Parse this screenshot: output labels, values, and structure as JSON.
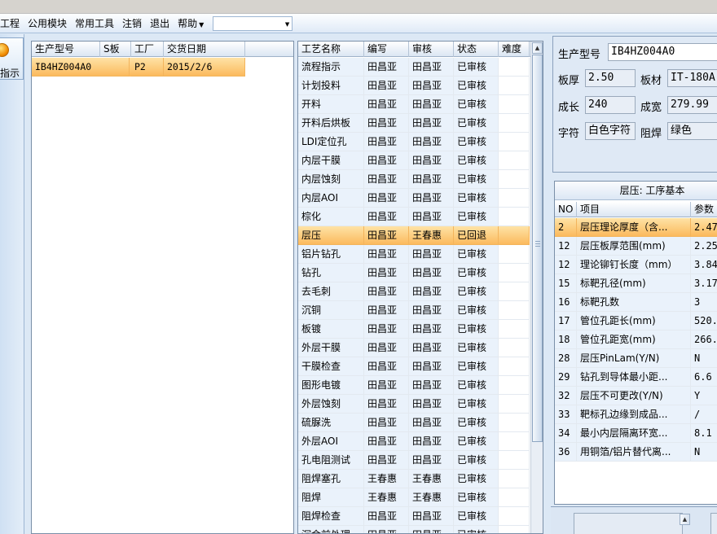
{
  "menu": {
    "items": [
      "工程",
      "公用模块",
      "常用工具",
      "注销",
      "退出",
      "帮助"
    ],
    "combo_value": ""
  },
  "leftbar": {
    "button_label": "指示"
  },
  "orders": {
    "headers": [
      "生产型号",
      "S板",
      "工厂",
      "交货日期"
    ],
    "rows": [
      {
        "model": "IB4HZ004A0",
        "s": "",
        "factory": "P2",
        "date": "2015/2/6"
      }
    ]
  },
  "processes": {
    "headers": [
      "工艺名称",
      "编写",
      "审核",
      "状态",
      "难度"
    ],
    "rows": [
      {
        "name": "流程指示",
        "writer": "田昌亚",
        "reviewer": "田昌亚",
        "status": "已审核"
      },
      {
        "name": "计划投料",
        "writer": "田昌亚",
        "reviewer": "田昌亚",
        "status": "已审核"
      },
      {
        "name": "开料",
        "writer": "田昌亚",
        "reviewer": "田昌亚",
        "status": "已审核"
      },
      {
        "name": "开料后烘板",
        "writer": "田昌亚",
        "reviewer": "田昌亚",
        "status": "已审核"
      },
      {
        "name": "LDI定位孔",
        "writer": "田昌亚",
        "reviewer": "田昌亚",
        "status": "已审核"
      },
      {
        "name": "内层干膜",
        "writer": "田昌亚",
        "reviewer": "田昌亚",
        "status": "已审核"
      },
      {
        "name": "内层蚀刻",
        "writer": "田昌亚",
        "reviewer": "田昌亚",
        "status": "已审核"
      },
      {
        "name": "内层AOI",
        "writer": "田昌亚",
        "reviewer": "田昌亚",
        "status": "已审核"
      },
      {
        "name": "棕化",
        "writer": "田昌亚",
        "reviewer": "田昌亚",
        "status": "已审核"
      },
      {
        "name": "层压",
        "writer": "田昌亚",
        "reviewer": "王春惠",
        "status": "已回退"
      },
      {
        "name": "铝片钻孔",
        "writer": "田昌亚",
        "reviewer": "田昌亚",
        "status": "已审核"
      },
      {
        "name": "钻孔",
        "writer": "田昌亚",
        "reviewer": "田昌亚",
        "status": "已审核"
      },
      {
        "name": "去毛刺",
        "writer": "田昌亚",
        "reviewer": "田昌亚",
        "status": "已审核"
      },
      {
        "name": "沉铜",
        "writer": "田昌亚",
        "reviewer": "田昌亚",
        "status": "已审核"
      },
      {
        "name": "板镀",
        "writer": "田昌亚",
        "reviewer": "田昌亚",
        "status": "已审核"
      },
      {
        "name": "外层干膜",
        "writer": "田昌亚",
        "reviewer": "田昌亚",
        "status": "已审核"
      },
      {
        "name": "干膜检查",
        "writer": "田昌亚",
        "reviewer": "田昌亚",
        "status": "已审核"
      },
      {
        "name": "图形电镀",
        "writer": "田昌亚",
        "reviewer": "田昌亚",
        "status": "已审核"
      },
      {
        "name": "外层蚀刻",
        "writer": "田昌亚",
        "reviewer": "田昌亚",
        "status": "已审核"
      },
      {
        "name": "硫脲洗",
        "writer": "田昌亚",
        "reviewer": "田昌亚",
        "status": "已审核"
      },
      {
        "name": "外层AOI",
        "writer": "田昌亚",
        "reviewer": "田昌亚",
        "status": "已审核"
      },
      {
        "name": "孔电阻测试",
        "writer": "田昌亚",
        "reviewer": "田昌亚",
        "status": "已审核"
      },
      {
        "name": "阻焊塞孔",
        "writer": "王春惠",
        "reviewer": "王春惠",
        "status": "已审核"
      },
      {
        "name": "阻焊",
        "writer": "王春惠",
        "reviewer": "王春惠",
        "status": "已审核"
      },
      {
        "name": "阻焊检查",
        "writer": "田昌亚",
        "reviewer": "田昌亚",
        "status": "已审核"
      },
      {
        "name": "沉金前处理",
        "writer": "田昌亚",
        "reviewer": "田昌亚",
        "status": "已审核"
      }
    ],
    "selected_index": 9
  },
  "info": {
    "model_label": "生产型号",
    "model_value": "IB4HZ004A0",
    "thickness_label": "板厚",
    "thickness_value": "2.50",
    "material_label": "板材",
    "material_value": "IT-180A",
    "length_label": "成长",
    "length_value": "240",
    "width_label": "成宽",
    "width_value": "279.99",
    "char_label": "字符",
    "char_value": "白色字符",
    "mask_label": "阻焊",
    "mask_value": "绿色"
  },
  "params": {
    "title": "层压: 工序基本",
    "headers": [
      "NO",
      "项目",
      "参数"
    ],
    "rows": [
      {
        "no": "2",
        "item": "层压理论厚度（含...",
        "value": "2.47"
      },
      {
        "no": "12",
        "item": "层压板厚范围(mm)",
        "value": "2.25"
      },
      {
        "no": "12",
        "item": "理论铆钉长度（mm）",
        "value": "3.84"
      },
      {
        "no": "15",
        "item": "标靶孔径(mm)",
        "value": "3.17"
      },
      {
        "no": "16",
        "item": "标靶孔数",
        "value": "3"
      },
      {
        "no": "17",
        "item": "管位孔距长(mm)",
        "value": "520."
      },
      {
        "no": "18",
        "item": "管位孔距宽(mm)",
        "value": "266."
      },
      {
        "no": "28",
        "item": "层压PinLam(Y/N)",
        "value": "N"
      },
      {
        "no": "29",
        "item": "钻孔到导体最小距...",
        "value": "6.6"
      },
      {
        "no": "32",
        "item": "层压不可更改(Y/N)",
        "value": "Y"
      },
      {
        "no": "33",
        "item": "靶标孔边缘到成品...",
        "value": "/"
      },
      {
        "no": "34",
        "item": "最小内层隔离环宽...",
        "value": "8.1"
      },
      {
        "no": "36",
        "item": "用铜箔/铝片替代离...",
        "value": "N"
      }
    ],
    "selected_index": 0
  }
}
